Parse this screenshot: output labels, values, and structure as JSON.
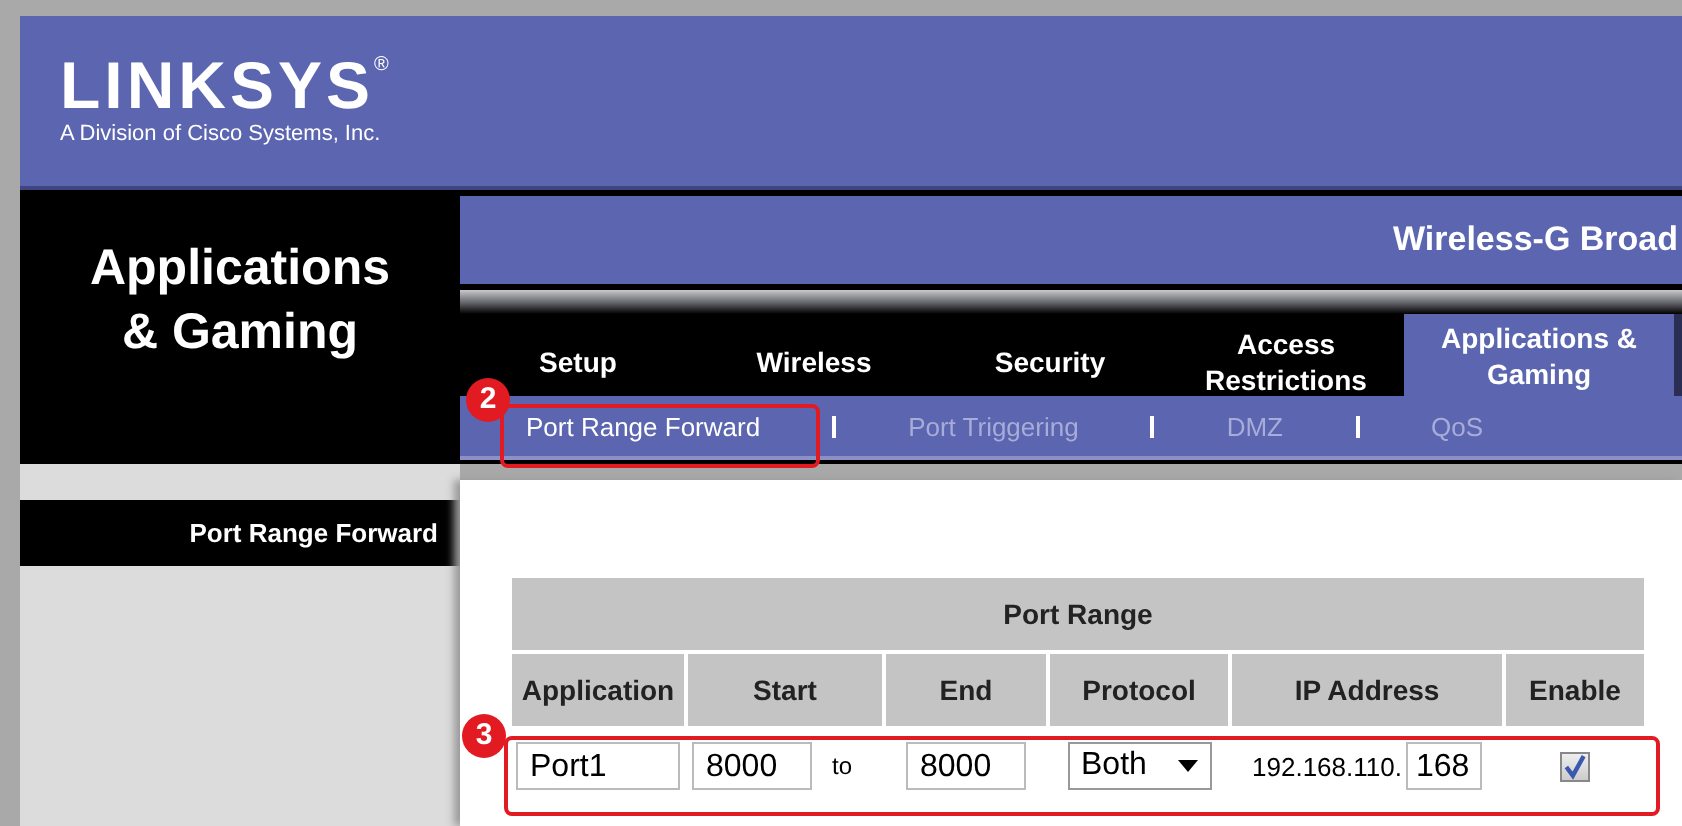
{
  "logo": {
    "brand": "LINKSYS",
    "registered": "®",
    "tagline": "A Division of Cisco Systems, Inc."
  },
  "section_title": "Applications & Gaming",
  "product_name": "Wireless-G Broad",
  "tabs": [
    {
      "label": "Setup",
      "selected": false
    },
    {
      "label": "Wireless",
      "selected": false
    },
    {
      "label": "Security",
      "selected": false
    },
    {
      "label": "Access Restrictions",
      "selected": false
    },
    {
      "label": "Applications & Gaming",
      "selected": true
    }
  ],
  "subtabs": [
    {
      "label": "Port Range Forward",
      "selected": true
    },
    {
      "label": "Port Triggering",
      "selected": false
    },
    {
      "label": "DMZ",
      "selected": false
    },
    {
      "label": "QoS",
      "selected": false
    }
  ],
  "sidebar": {
    "items": [
      {
        "label": "Port Range Forward"
      }
    ]
  },
  "table": {
    "title": "Port Range",
    "columns": [
      "Application",
      "Start",
      "End",
      "Protocol",
      "IP Address",
      "Enable"
    ],
    "rows": [
      {
        "application": "Port1",
        "start": "8000",
        "range_word": "to",
        "end": "8000",
        "protocol": "Both",
        "ip_prefix": "192.168.110.",
        "ip_last": "168",
        "enable": true
      }
    ]
  },
  "callouts": [
    {
      "label": "2"
    },
    {
      "label": "3"
    }
  ]
}
